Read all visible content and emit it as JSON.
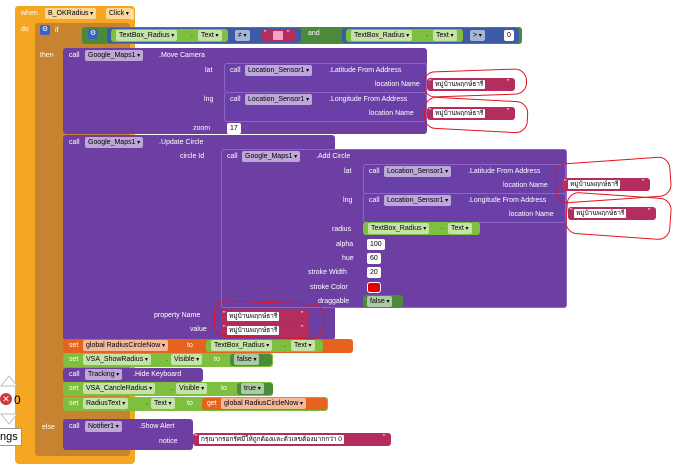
{
  "event": {
    "when": "when",
    "component": "B_OKRadius",
    "event": "Click",
    "do": "do"
  },
  "if_block": {
    "if": "if",
    "then": "then",
    "else": "else",
    "and": "and",
    "left_component": "TextBox_Radius",
    "left_prop": "Text",
    "neq": "≠",
    "empty_text": "",
    "right_component": "TextBox_Radius",
    "right_prop": "Text",
    "gt": ">",
    "zero": "0"
  },
  "move_camera": {
    "call": "call",
    "component": "Google_Maps1",
    "method": ".Move Camera",
    "lat_label": "lat",
    "lng_label": "lng",
    "zoom_label": "zoom",
    "zoom": "17",
    "lat_call": {
      "component": "Location_Sensor1",
      "method": ".Latitude From Address",
      "arg": "location Name",
      "value": "หมู่บ้านพฤกษ์ธารี"
    },
    "lng_call": {
      "component": "Location_Sensor1",
      "method": ".Longitude From Address",
      "arg": "location Name",
      "value": "หมู่บ้านพฤกษ์ธารี"
    }
  },
  "update_circle": {
    "call": "call",
    "component": "Google_Maps1",
    "method": ".Update Circle",
    "circle_id": "circle Id",
    "add_circle": {
      "component": "Google_Maps1",
      "method": ".Add Circle",
      "lat_label": "lat",
      "lng_label": "lng",
      "lat_call": {
        "component": "Location_Sensor1",
        "method": ".Latitude From Address",
        "arg": "location Name",
        "value": "หมู่บ้านพฤกษ์ธารี"
      },
      "lng_call": {
        "component": "Location_Sensor1",
        "method": ".Longitude From Address",
        "arg": "location Name",
        "value": "หมู่บ้านพฤกษ์ธารี"
      },
      "radius_label": "radius",
      "radius_component": "TextBox_Radius",
      "radius_prop": "Text",
      "alpha_label": "alpha",
      "alpha": "100",
      "hue_label": "hue",
      "hue": "60",
      "stroke_width_label": "stroke Width",
      "stroke_width": "20",
      "stroke_color_label": "stroke Color",
      "stroke_color": "#e00000",
      "draggable_label": "draggable",
      "draggable": "false"
    },
    "property_name_label": "property Name",
    "property_name": "หมู่บ้านพฤกษ์ธารี",
    "value_label": "value",
    "value": "หมู่บ้านพฤกษ์ธารี"
  },
  "stmts": {
    "set1": {
      "set": "set",
      "var": "global RadiusCircleNow",
      "to": "to",
      "component": "TextBox_Radius",
      "prop": "Text"
    },
    "set2": {
      "set": "set",
      "component": "VSA_ShowRadius",
      "prop": "Visible",
      "to": "to",
      "value": "false"
    },
    "call1": {
      "call": "call",
      "component": "Tracking",
      "method": ".Hide Keyboard"
    },
    "set3": {
      "set": "set",
      "component": "VSA_CancleRadius",
      "prop": "Visible",
      "to": "to",
      "value": "true"
    },
    "set4": {
      "set": "set",
      "component": "RadiusText",
      "prop": "Text",
      "to": "to",
      "get": "get",
      "var": "global RadiusCircleNow"
    },
    "alert": {
      "call": "call",
      "component": "Notifier1",
      "method": ".Show Alert",
      "arg": "notice",
      "value": "กรุณากรอกรัศมีให้ถูกต้องและตัวเลขต้องมากกว่า 0"
    }
  },
  "workspace": {
    "warning_count": "0",
    "partial_label": "ngs"
  },
  "colors": {
    "event": "#f5a623",
    "control": "#c88330",
    "maps": "#6e3fa3",
    "location": "#6b3fa8",
    "text": "#b32d5e",
    "math": "#3b5ba5",
    "logic": "#4b8a3a",
    "variable": "#e6621f",
    "component": "#7fbf3f"
  }
}
